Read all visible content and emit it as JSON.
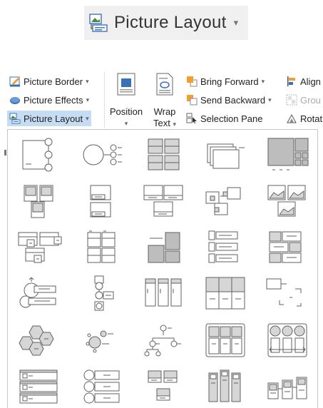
{
  "banner": {
    "title": "Picture Layout",
    "caret": "▾",
    "icon": "picture-layout-icon"
  },
  "ribbon": {
    "picture_border": "Picture Border",
    "picture_effects": "Picture Effects",
    "picture_layout": "Picture Layout",
    "position": "Position",
    "wrap": "Wrap",
    "text": "Text",
    "bring_forward": "Bring Forward",
    "send_backward": "Send Backward",
    "selection_pane": "Selection Pane",
    "align": "Align",
    "group": "Grou",
    "rotate": "Rotat",
    "caret": "▾",
    "colors": {
      "blue": "#3a70b8",
      "orange": "#f0a030",
      "selected": "#c6dcf3"
    }
  },
  "gallery": {
    "rows": 6,
    "columns": 5,
    "layouts": [
      "bending-picture-accent-list",
      "circular-picture-callout",
      "picture-grid",
      "snapshot-picture-list",
      "picture-lineup",
      "accented-picture",
      "captioned-pictures",
      "bending-picture-caption",
      "bending-picture-blocks",
      "bending-picture-semi-transparent-text",
      "picture-caption-list",
      "picture-frame",
      "framed-text-picture",
      "vertical-picture-list",
      "alternating-picture-blocks",
      "picture-accent-process",
      "picture-accent-list",
      "vertical-picture-accent-list",
      "title-picture-lineup",
      "picture-organization-chart",
      "hexagon-cluster",
      "circle-picture-hierarchy",
      "hierarchy-pictures",
      "title-picture-blocks",
      "picture-strips",
      "horizontal-picture-list",
      "continuous-picture-list",
      "ascending-picture-accent",
      "picture-accent-blocks",
      "phased-process"
    ]
  }
}
